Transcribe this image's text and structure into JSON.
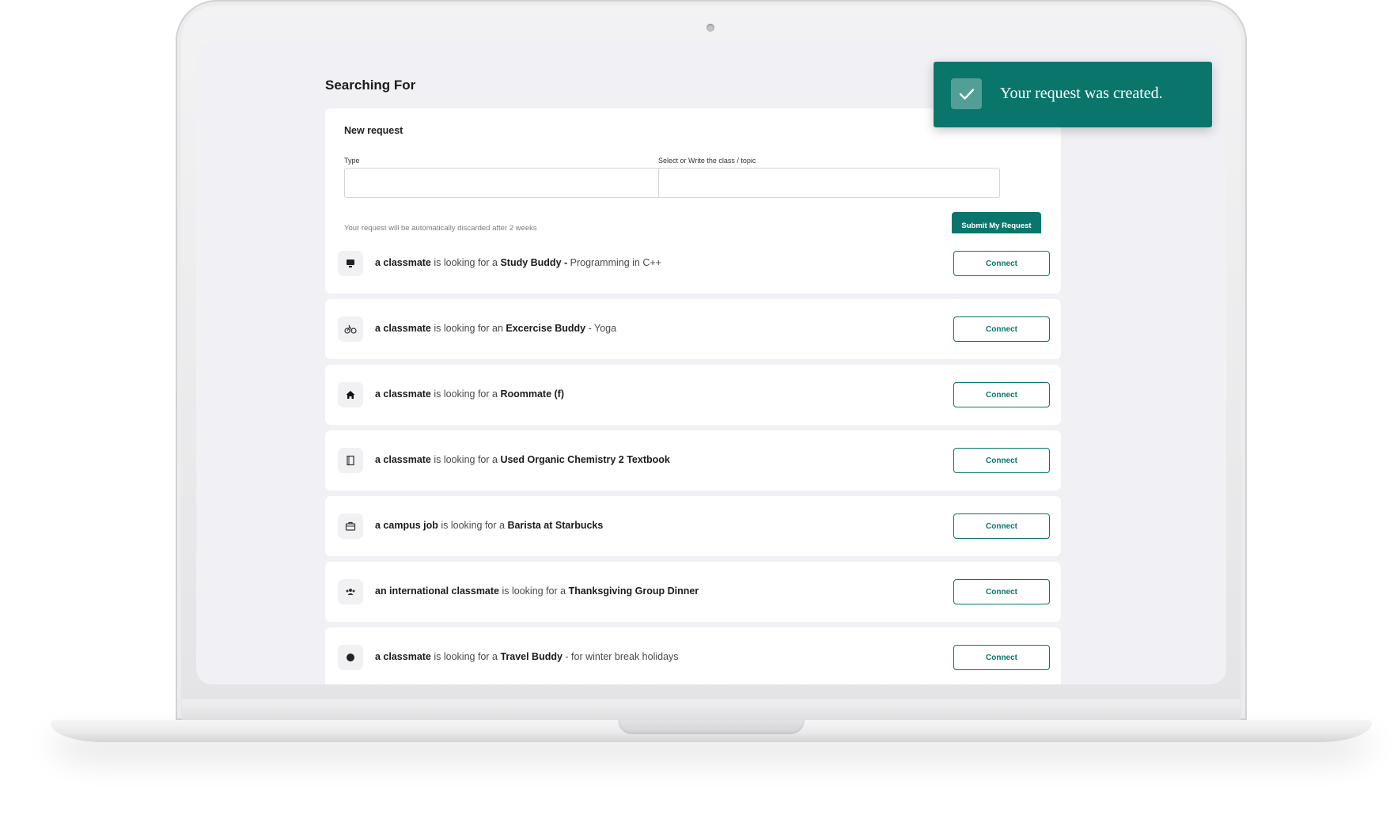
{
  "app": {
    "page_title": "Searching For"
  },
  "new_request": {
    "heading": "New request",
    "type_label": "Type",
    "type_value": "",
    "topic_label": "Select or Write the class / topic",
    "topic_value": "",
    "hint": "Your request will be automatically discarded after 2 weeks",
    "submit_label": "Submit My Request"
  },
  "requests": [
    {
      "icon": "monitor-icon",
      "who": "a classmate",
      "verb": " is looking for a ",
      "what": "Study Buddy - ",
      "detail": "Programming in C++",
      "connect_label": "Connect"
    },
    {
      "icon": "bicycle-icon",
      "who": "a classmate",
      "verb": " is looking for an ",
      "what": "Excercise Buddy",
      "detail": " - Yoga",
      "connect_label": "Connect"
    },
    {
      "icon": "house-icon",
      "who": "a classmate",
      "verb": " is looking for a ",
      "what": "Roommate (f)",
      "detail": "",
      "connect_label": "Connect"
    },
    {
      "icon": "book-icon",
      "who": "a classmate",
      "verb": " is looking for a ",
      "what": "Used Organic Chemistry 2 Textbook",
      "detail": "",
      "connect_label": "Connect"
    },
    {
      "icon": "briefcase-icon",
      "who": "a campus job",
      "verb": " is looking for a ",
      "what": "Barista at Starbucks",
      "detail": "",
      "connect_label": "Connect"
    },
    {
      "icon": "group-icon",
      "who": "an international classmate",
      "verb": " is looking for a ",
      "what": "Thanksgiving Group Dinner",
      "detail": "",
      "connect_label": "Connect"
    },
    {
      "icon": "globe-icon",
      "who": "a classmate",
      "verb": " is looking for a ",
      "what": "Travel Buddy",
      "detail": " - for winter break holidays",
      "connect_label": "Connect"
    }
  ],
  "toast": {
    "message": "Your request was created.",
    "icon": "check-icon"
  },
  "colors": {
    "accent": "#0a766b",
    "screen_bg": "#f1f1f5",
    "card_bg": "#ffffff"
  }
}
